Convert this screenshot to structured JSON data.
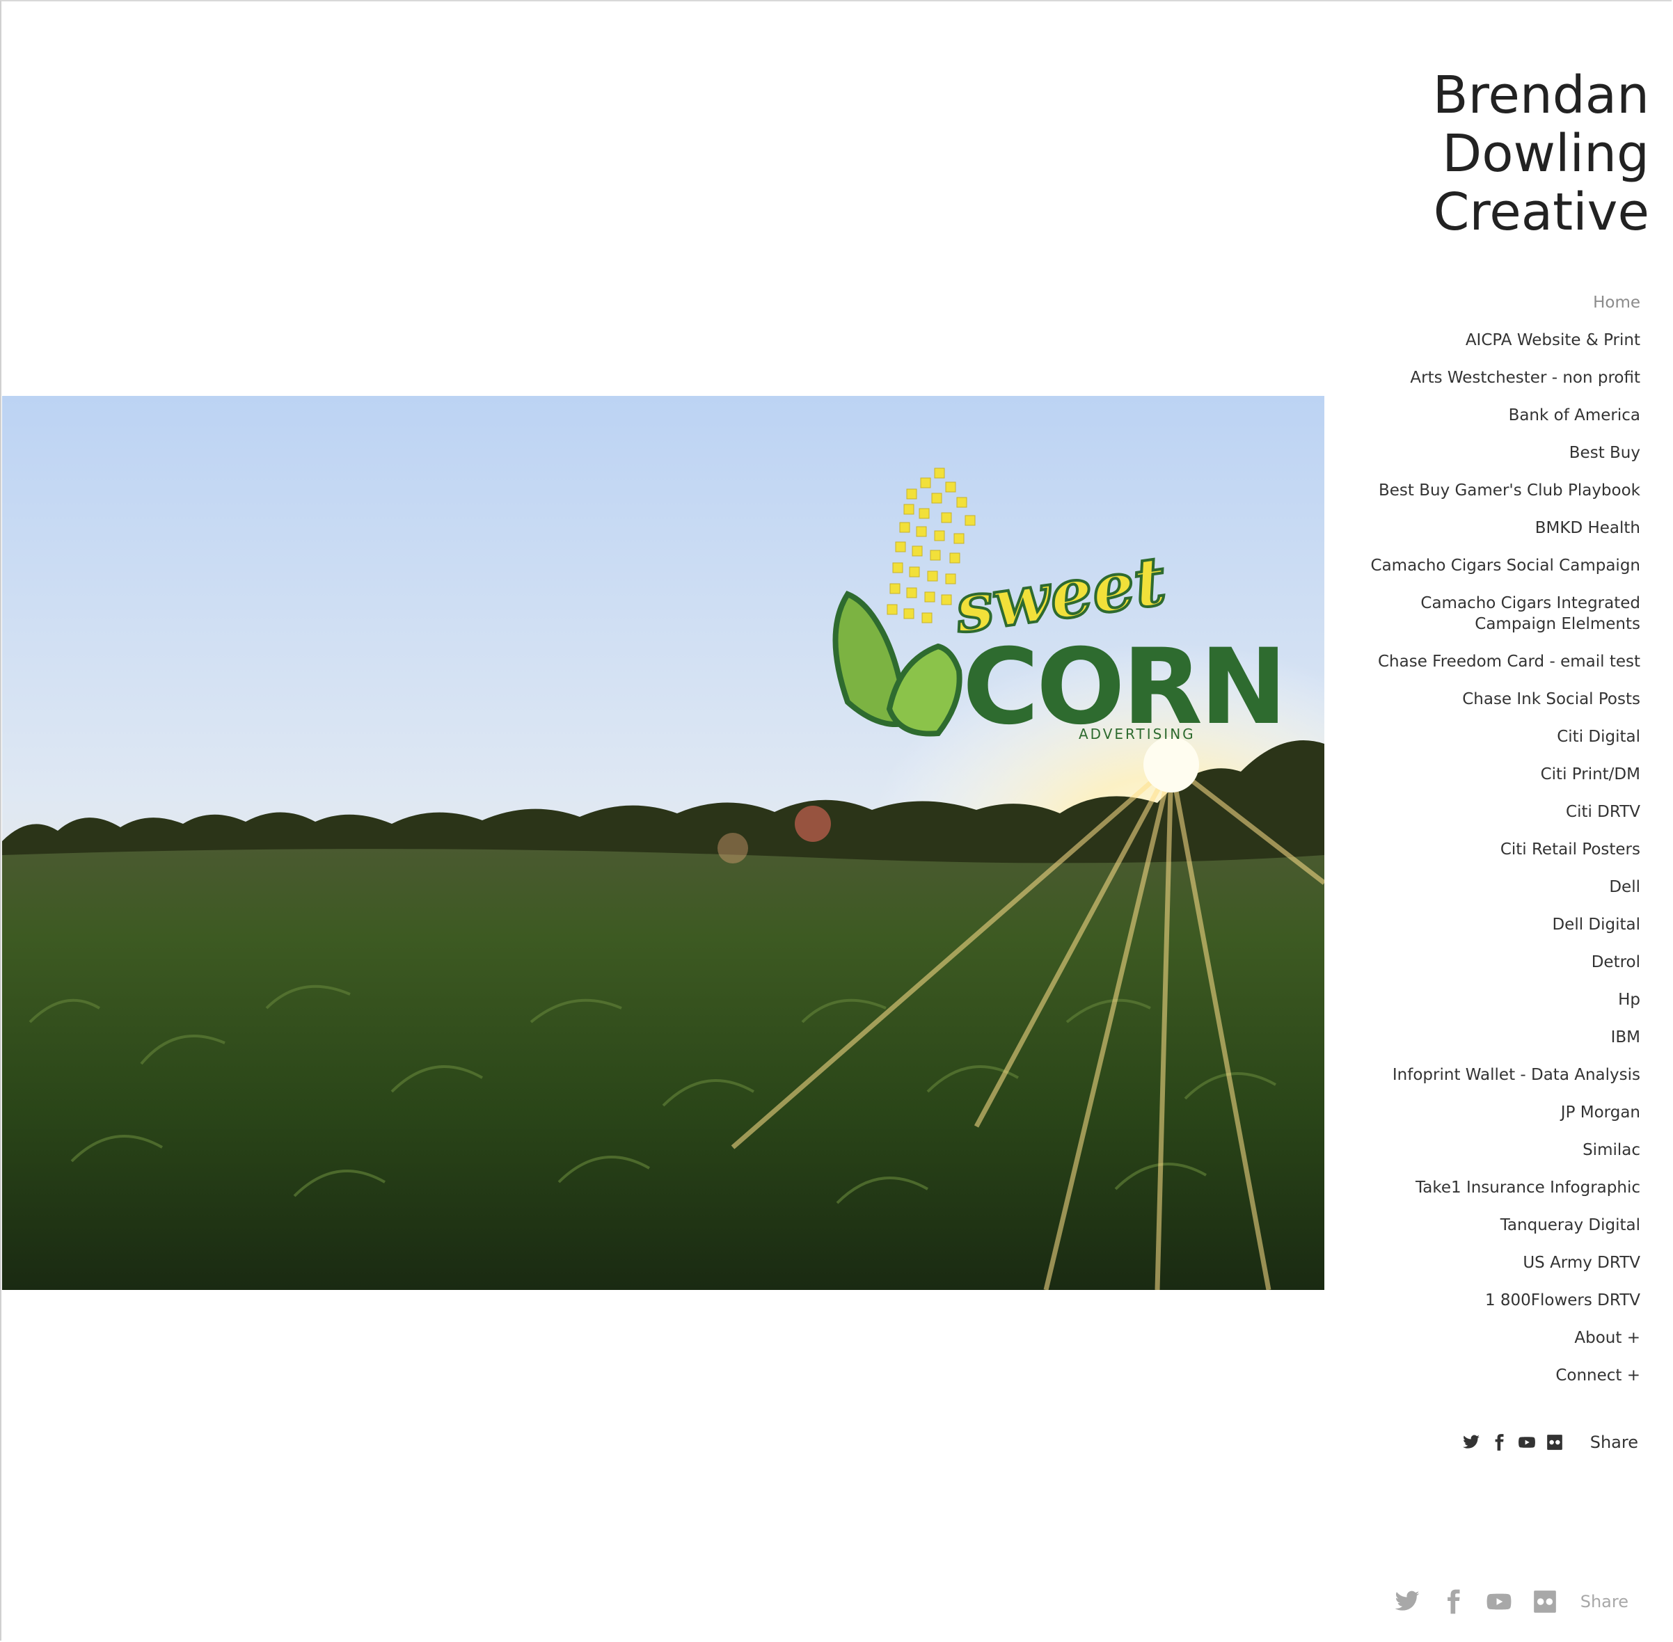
{
  "site": {
    "title_lines": [
      "Brendan",
      "Dowling",
      "Creative"
    ]
  },
  "hero": {
    "logo_word_top": "sweet",
    "logo_word_main": "CORN",
    "logo_word_sub": "ADVERTISING"
  },
  "nav": {
    "items": [
      {
        "label": "Home",
        "active": true
      },
      {
        "label": "AICPA Website & Print"
      },
      {
        "label": "Arts Westchester - non profit"
      },
      {
        "label": "Bank of America"
      },
      {
        "label": "Best Buy"
      },
      {
        "label": "Best Buy Gamer's Club Playbook"
      },
      {
        "label": "BMKD Health"
      },
      {
        "label": "Camacho Cigars Social Campaign"
      },
      {
        "label": "Camacho Cigars Integrated Campaign Elelments"
      },
      {
        "label": "Chase Freedom Card - email test"
      },
      {
        "label": "Chase Ink Social Posts"
      },
      {
        "label": "Citi Digital"
      },
      {
        "label": "Citi Print/DM"
      },
      {
        "label": "Citi DRTV"
      },
      {
        "label": "Citi Retail Posters"
      },
      {
        "label": "Dell"
      },
      {
        "label": "Dell Digital"
      },
      {
        "label": "Detrol"
      },
      {
        "label": "Hp"
      },
      {
        "label": "IBM"
      },
      {
        "label": "Infoprint Wallet - Data Analysis"
      },
      {
        "label": "JP Morgan"
      },
      {
        "label": "Similac"
      },
      {
        "label": "Take1 Insurance Infographic"
      },
      {
        "label": "Tanqueray Digital"
      },
      {
        "label": "US Army DRTV"
      },
      {
        "label": "1 800Flowers DRTV"
      },
      {
        "label": "About +"
      },
      {
        "label": "Connect +"
      }
    ]
  },
  "social": {
    "icons": [
      "twitter-icon",
      "facebook-icon",
      "youtube-icon",
      "flickr-icon"
    ],
    "share_label": "Share"
  },
  "colors": {
    "text": "#333333",
    "muted": "#8b8b8b",
    "icon_light": "#a8a8a8",
    "logo_green": "#2e6b2f",
    "logo_yellow": "#f1e03a"
  }
}
